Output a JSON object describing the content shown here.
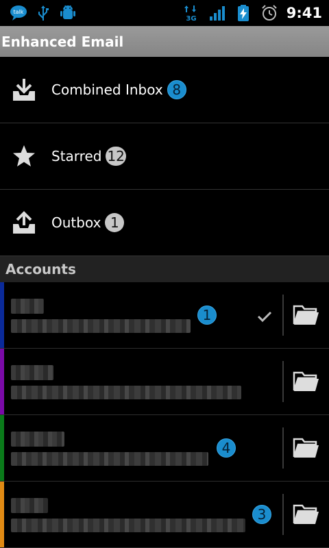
{
  "status_bar": {
    "time": "9:41",
    "talk_icon_text": "talk",
    "network_label": "3G"
  },
  "title_bar": {
    "title": "Enhanced Email"
  },
  "mailboxes": [
    {
      "label": "Combined Inbox",
      "count": "8",
      "badge_color": "#1a8dce"
    },
    {
      "label": "Starred",
      "count": "12",
      "badge_color": "#c7c7c7"
    },
    {
      "label": "Outbox",
      "count": "1",
      "badge_color": "#c7c7c7"
    }
  ],
  "accounts_header": "Accounts",
  "accounts": [
    {
      "color": "#0a2a9a",
      "unread": "1",
      "selected": true
    },
    {
      "color": "#7a0aa8",
      "unread": "",
      "selected": false
    },
    {
      "color": "#0a7a1a",
      "unread": "4",
      "selected": false
    },
    {
      "color": "#e08a14",
      "unread": "3",
      "selected": false
    }
  ],
  "colors": {
    "accent_blue": "#1a8dce",
    "title_bar": "#8f8f8f",
    "section_header": "#222222"
  }
}
